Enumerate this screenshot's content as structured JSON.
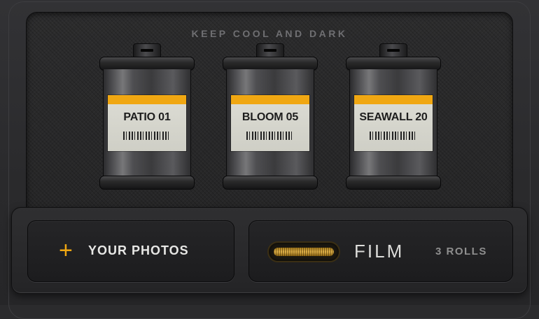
{
  "shelf": {
    "title": "KEEP COOL AND DARK",
    "canisters": [
      {
        "name": "PATIO 01"
      },
      {
        "name": "BLOOM 05"
      },
      {
        "name": "SEAWALL 20"
      }
    ]
  },
  "tray": {
    "photos_button": {
      "icon": "plus-icon",
      "label": "YOUR PHOTOS"
    },
    "film_button": {
      "icon": "film-slot-icon",
      "label": "FILM",
      "count_label": "3 ROLLS"
    }
  },
  "colors": {
    "accent": "#f0a712",
    "label_paper": "#d6d6ce",
    "background": "#2b2b2d"
  }
}
